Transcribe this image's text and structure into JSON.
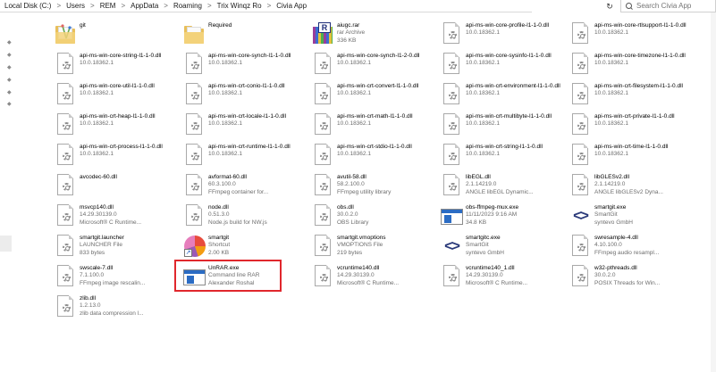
{
  "address_bar": {
    "crumbs": [
      "Local Disk (C:)",
      "Users",
      "REM",
      "AppData",
      "Roaming",
      "Trix Winqz Ro",
      "Civia App"
    ],
    "separator": ">"
  },
  "search": {
    "placeholder": "Search Civia App"
  },
  "items": [
    {
      "name": "git",
      "sub1": "",
      "sub2": "",
      "icon": "git-folder-icon"
    },
    {
      "name": "Required",
      "sub1": "",
      "sub2": "",
      "icon": "folder-icon"
    },
    {
      "name": "aiugc.rar",
      "sub1": "rar Archive",
      "sub2": "336 KB",
      "icon": "rar-archive-icon"
    },
    {
      "name": "api-ms-win-core-profile-l1-1-0.dll",
      "sub1": "10.0.18362.1",
      "sub2": "",
      "icon": "dll-file-icon",
      "two": true
    },
    {
      "name": "api-ms-win-core-rtlsupport-l1-1-0.dll",
      "sub1": "10.0.18362.1",
      "sub2": "",
      "icon": "dll-file-icon",
      "two": true
    },
    {
      "name": "api-ms-win-core-string-l1-1-0.dll",
      "sub1": "10.0.18362.1",
      "sub2": "",
      "icon": "dll-file-icon",
      "two": true
    },
    {
      "name": "api-ms-win-core-synch-l1-1-0.dll",
      "sub1": "10.0.18362.1",
      "sub2": "",
      "icon": "dll-file-icon",
      "two": true
    },
    {
      "name": "api-ms-win-core-synch-l1-2-0.dll",
      "sub1": "10.0.18362.1",
      "sub2": "",
      "icon": "dll-file-icon",
      "two": true
    },
    {
      "name": "api-ms-win-core-sysinfo-l1-1-0.dll",
      "sub1": "10.0.18362.1",
      "sub2": "",
      "icon": "dll-file-icon",
      "two": true
    },
    {
      "name": "api-ms-win-core-timezone-l1-1-0.dll",
      "sub1": "10.0.18362.1",
      "sub2": "",
      "icon": "dll-file-icon",
      "two": true
    },
    {
      "name": "api-ms-win-core-util-l1-1-0.dll",
      "sub1": "10.0.18362.1",
      "sub2": "",
      "icon": "dll-file-icon",
      "two": true
    },
    {
      "name": "api-ms-win-crt-conio-l1-1-0.dll",
      "sub1": "10.0.18362.1",
      "sub2": "",
      "icon": "dll-file-icon",
      "two": true
    },
    {
      "name": "api-ms-win-crt-convert-l1-1-0.dll",
      "sub1": "10.0.18362.1",
      "sub2": "",
      "icon": "dll-file-icon",
      "two": true
    },
    {
      "name": "api-ms-win-crt-environment-l1-1-0.dll",
      "sub1": "10.0.18362.1",
      "sub2": "",
      "icon": "dll-file-icon",
      "two": true
    },
    {
      "name": "api-ms-win-crt-filesystem-l1-1-0.dll",
      "sub1": "10.0.18362.1",
      "sub2": "",
      "icon": "dll-file-icon",
      "two": true
    },
    {
      "name": "api-ms-win-crt-heap-l1-1-0.dll",
      "sub1": "10.0.18362.1",
      "sub2": "",
      "icon": "dll-file-icon",
      "two": true
    },
    {
      "name": "api-ms-win-crt-locale-l1-1-0.dll",
      "sub1": "10.0.18362.1",
      "sub2": "",
      "icon": "dll-file-icon",
      "two": true
    },
    {
      "name": "api-ms-win-crt-math-l1-1-0.dll",
      "sub1": "10.0.18362.1",
      "sub2": "",
      "icon": "dll-file-icon",
      "two": true
    },
    {
      "name": "api-ms-win-crt-multibyte-l1-1-0.dll",
      "sub1": "10.0.18362.1",
      "sub2": "",
      "icon": "dll-file-icon",
      "two": true
    },
    {
      "name": "api-ms-win-crt-private-l1-1-0.dll",
      "sub1": "10.0.18362.1",
      "sub2": "",
      "icon": "dll-file-icon",
      "two": true
    },
    {
      "name": "api-ms-win-crt-process-l1-1-0.dll",
      "sub1": "10.0.18362.1",
      "sub2": "",
      "icon": "dll-file-icon",
      "two": true
    },
    {
      "name": "api-ms-win-crt-runtime-l1-1-0.dll",
      "sub1": "10.0.18362.1",
      "sub2": "",
      "icon": "dll-file-icon",
      "two": true
    },
    {
      "name": "api-ms-win-crt-stdio-l1-1-0.dll",
      "sub1": "10.0.18362.1",
      "sub2": "",
      "icon": "dll-file-icon",
      "two": true
    },
    {
      "name": "api-ms-win-crt-string-l1-1-0.dll",
      "sub1": "10.0.18362.1",
      "sub2": "",
      "icon": "dll-file-icon",
      "two": true
    },
    {
      "name": "api-ms-win-crt-time-l1-1-0.dll",
      "sub1": "10.0.18362.1",
      "sub2": "",
      "icon": "dll-file-icon",
      "two": true
    },
    {
      "name": "avcodec-60.dll",
      "sub1": "",
      "sub2": "",
      "icon": "dll-file-icon"
    },
    {
      "name": "avformat-60.dll",
      "sub1": "60.3.100.0",
      "sub2": "FFmpeg container for...",
      "icon": "dll-file-icon"
    },
    {
      "name": "avutil-58.dll",
      "sub1": "58.2.100.0",
      "sub2": "FFmpeg utility library",
      "icon": "dll-file-icon"
    },
    {
      "name": "libEGL.dll",
      "sub1": "2.1.14219.0",
      "sub2": "ANGLE libEGL Dynamic...",
      "icon": "dll-file-icon"
    },
    {
      "name": "libGLESv2.dll",
      "sub1": "2.1.14219.0",
      "sub2": "ANGLE libGLESv2 Dyna...",
      "icon": "dll-file-icon"
    },
    {
      "name": "msvcp140.dll",
      "sub1": "14.29.30139.0",
      "sub2": "Microsoft® C Runtime...",
      "icon": "dll-file-icon"
    },
    {
      "name": "node.dll",
      "sub1": "0.51.3.0",
      "sub2": "Node.js build for NW.js",
      "icon": "dll-file-icon"
    },
    {
      "name": "obs.dll",
      "sub1": "30.0.2.0",
      "sub2": "OBS Library",
      "icon": "dll-file-icon"
    },
    {
      "name": "obs-ffmpeg-mux.exe",
      "sub1": "11/11/2023 9:16 AM",
      "sub2": "34.8 KB",
      "icon": "exe-window-icon"
    },
    {
      "name": "smartgit.exe",
      "sub1": "SmartGit",
      "sub2": "syntevo GmbH",
      "icon": "smartgit-icon"
    },
    {
      "name": "smartgit.launcher",
      "sub1": "LAUNCHER File",
      "sub2": "833 bytes",
      "icon": "file-icon"
    },
    {
      "name": "smartgit",
      "sub1": "Shortcut",
      "sub2": "2.00 KB",
      "icon": "shortcut-icon"
    },
    {
      "name": "smartgit.vmoptions",
      "sub1": "VMOPTIONS File",
      "sub2": "219 bytes",
      "icon": "file-icon"
    },
    {
      "name": "smartgitc.exe",
      "sub1": "SmartGit",
      "sub2": "syntevo GmbH",
      "icon": "smartgit-icon"
    },
    {
      "name": "swresample-4.dll",
      "sub1": "4.10.100.0",
      "sub2": "FFmpeg audio resampl...",
      "icon": "dll-file-icon"
    },
    {
      "name": "swscale-7.dll",
      "sub1": "7.1.100.0",
      "sub2": "FFmpeg image rescalin...",
      "icon": "dll-file-icon"
    },
    {
      "name": "UnRAR.exe",
      "sub1": "Command line RAR",
      "sub2": "Alexander Roshal",
      "icon": "exe-window-icon"
    },
    {
      "name": "vcruntime140.dll",
      "sub1": "14.29.30139.0",
      "sub2": "Microsoft® C Runtime...",
      "icon": "dll-file-icon"
    },
    {
      "name": "vcruntime140_1.dll",
      "sub1": "14.29.30139.0",
      "sub2": "Microsoft® C Runtime...",
      "icon": "dll-file-icon"
    },
    {
      "name": "w32-pthreads.dll",
      "sub1": "30.0.2.0",
      "sub2": "POSIX Threads for Win...",
      "icon": "dll-file-icon"
    },
    {
      "name": "zlib.dll",
      "sub1": "1.2.13.0",
      "sub2": "zlib data compression l...",
      "icon": "dll-file-icon"
    }
  ]
}
